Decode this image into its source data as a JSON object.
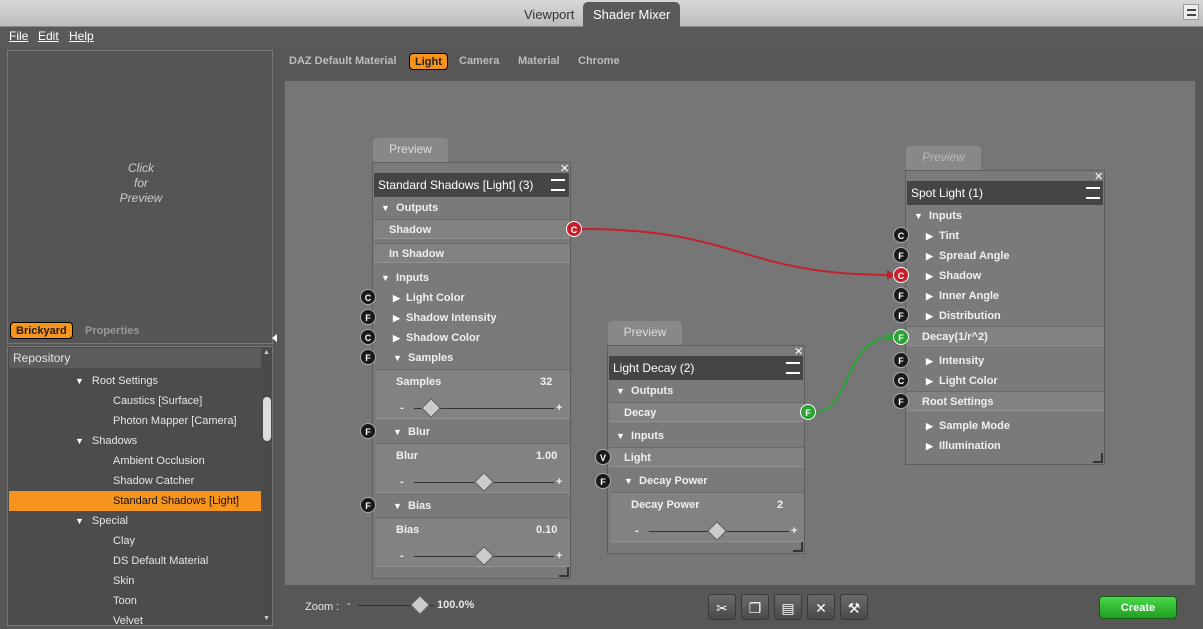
{
  "tabs": {
    "viewport": "Viewport",
    "shader_mixer": "Shader Mixer"
  },
  "menu": {
    "file": "File",
    "edit": "Edit",
    "help": "Help"
  },
  "preview": {
    "text_l1": "Click",
    "text_l2": "for",
    "text_l3": "Preview"
  },
  "panel_tabs": {
    "brickyard": "Brickyard",
    "properties": "Properties"
  },
  "repository": {
    "header": "Repository",
    "items": [
      {
        "label": "Root Settings",
        "level": 1,
        "arrow": "▼"
      },
      {
        "label": "Caustics [Surface]",
        "level": 2
      },
      {
        "label": "Photon Mapper [Camera]",
        "level": 2
      },
      {
        "label": "Shadows",
        "level": 1,
        "arrow": "▼"
      },
      {
        "label": "Ambient Occlusion",
        "level": 2
      },
      {
        "label": "Shadow Catcher",
        "level": 2
      },
      {
        "label": "Standard Shadows [Light]",
        "level": 2,
        "selected": true
      },
      {
        "label": "Special",
        "level": 1,
        "arrow": "▼"
      },
      {
        "label": "Clay",
        "level": 2
      },
      {
        "label": "DS Default Material",
        "level": 2
      },
      {
        "label": "Skin",
        "level": 2
      },
      {
        "label": "Toon",
        "level": 2
      },
      {
        "label": "Velvet",
        "level": 2
      }
    ]
  },
  "mixer_tabs": {
    "t1": "DAZ Default Material",
    "t2": "Light",
    "t3": "Camera",
    "t4": "Material",
    "t5": "Chrome"
  },
  "node_shadows": {
    "preview_tab": "Preview",
    "title": "Standard Shadows [Light] (3)",
    "outputs": "Outputs",
    "out1": "Shadow",
    "out2": "In Shadow",
    "inputs": "Inputs",
    "in1": "Light Color",
    "in2": "Shadow Intensity",
    "in3": "Shadow Color",
    "in4": "Samples",
    "samples_label": "Samples",
    "samples_value": "32",
    "blur": "Blur",
    "blur_label": "Blur",
    "blur_value": "1.00",
    "bias": "Bias",
    "bias_label": "Bias",
    "bias_value": "0.10",
    "minus": "-",
    "plus": "+"
  },
  "node_decay": {
    "preview_tab": "Preview",
    "title": "Light Decay (2)",
    "outputs": "Outputs",
    "out1": "Decay",
    "inputs": "Inputs",
    "in1": "Light",
    "in2": "Decay Power",
    "power_label": "Decay Power",
    "power_value": "2"
  },
  "node_spot": {
    "preview_tab": "Preview",
    "title": "Spot Light (1)",
    "inputs": "Inputs",
    "i1": "Tint",
    "i2": "Spread Angle",
    "i3": "Shadow",
    "i4": "Inner Angle",
    "i5": "Distribution",
    "i6": "Decay(1/r^2)",
    "i7": "Intensity",
    "i8": "Light Color",
    "i9": "Root Settings",
    "i10": "Sample Mode",
    "i11": "Illumination"
  },
  "badges": {
    "c": "C",
    "f": "F",
    "v": "V"
  },
  "zoom": {
    "label": "Zoom :",
    "minus": "-",
    "value": "100.0%"
  },
  "create": "Create",
  "colors": {
    "accent": "#f7941d",
    "wire_red": "#c41f2d",
    "wire_green": "#2aa534"
  }
}
